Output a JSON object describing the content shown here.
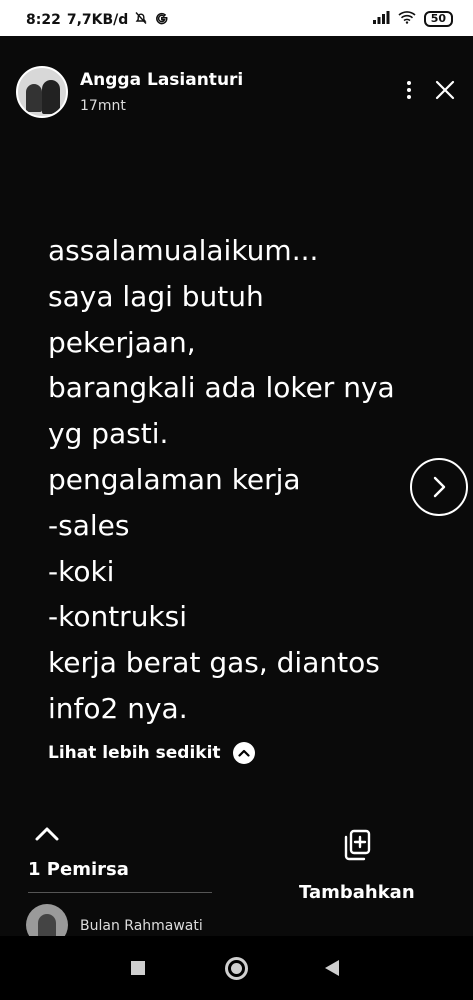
{
  "status_bar": {
    "time": "8:22",
    "data_rate": "7,7KB/d",
    "battery": "50",
    "icons": [
      "muted-bell-icon",
      "google-icon",
      "signal-icon",
      "wifi-icon",
      "battery-icon"
    ]
  },
  "story": {
    "author_name": "Angga Lasianturi",
    "time_ago": "17mnt",
    "text_lines": [
      "assalamualaikum...",
      "saya lagi butuh",
      "pekerjaan,",
      "barangkali ada loker nya",
      "yg pasti.",
      "pengalaman kerja",
      "-sales",
      "-koki",
      "-kontruksi",
      "kerja berat gas, diantos",
      "info2 nya."
    ],
    "see_less_label": "Lihat lebih sedikit"
  },
  "viewers": {
    "count_label": "1 Pemirsa",
    "list": [
      {
        "name": "Bulan Rahmawati"
      }
    ]
  },
  "add": {
    "label": "Tambahkan"
  },
  "colors": {
    "background": "#0a0a0a",
    "text": "#ffffff"
  }
}
